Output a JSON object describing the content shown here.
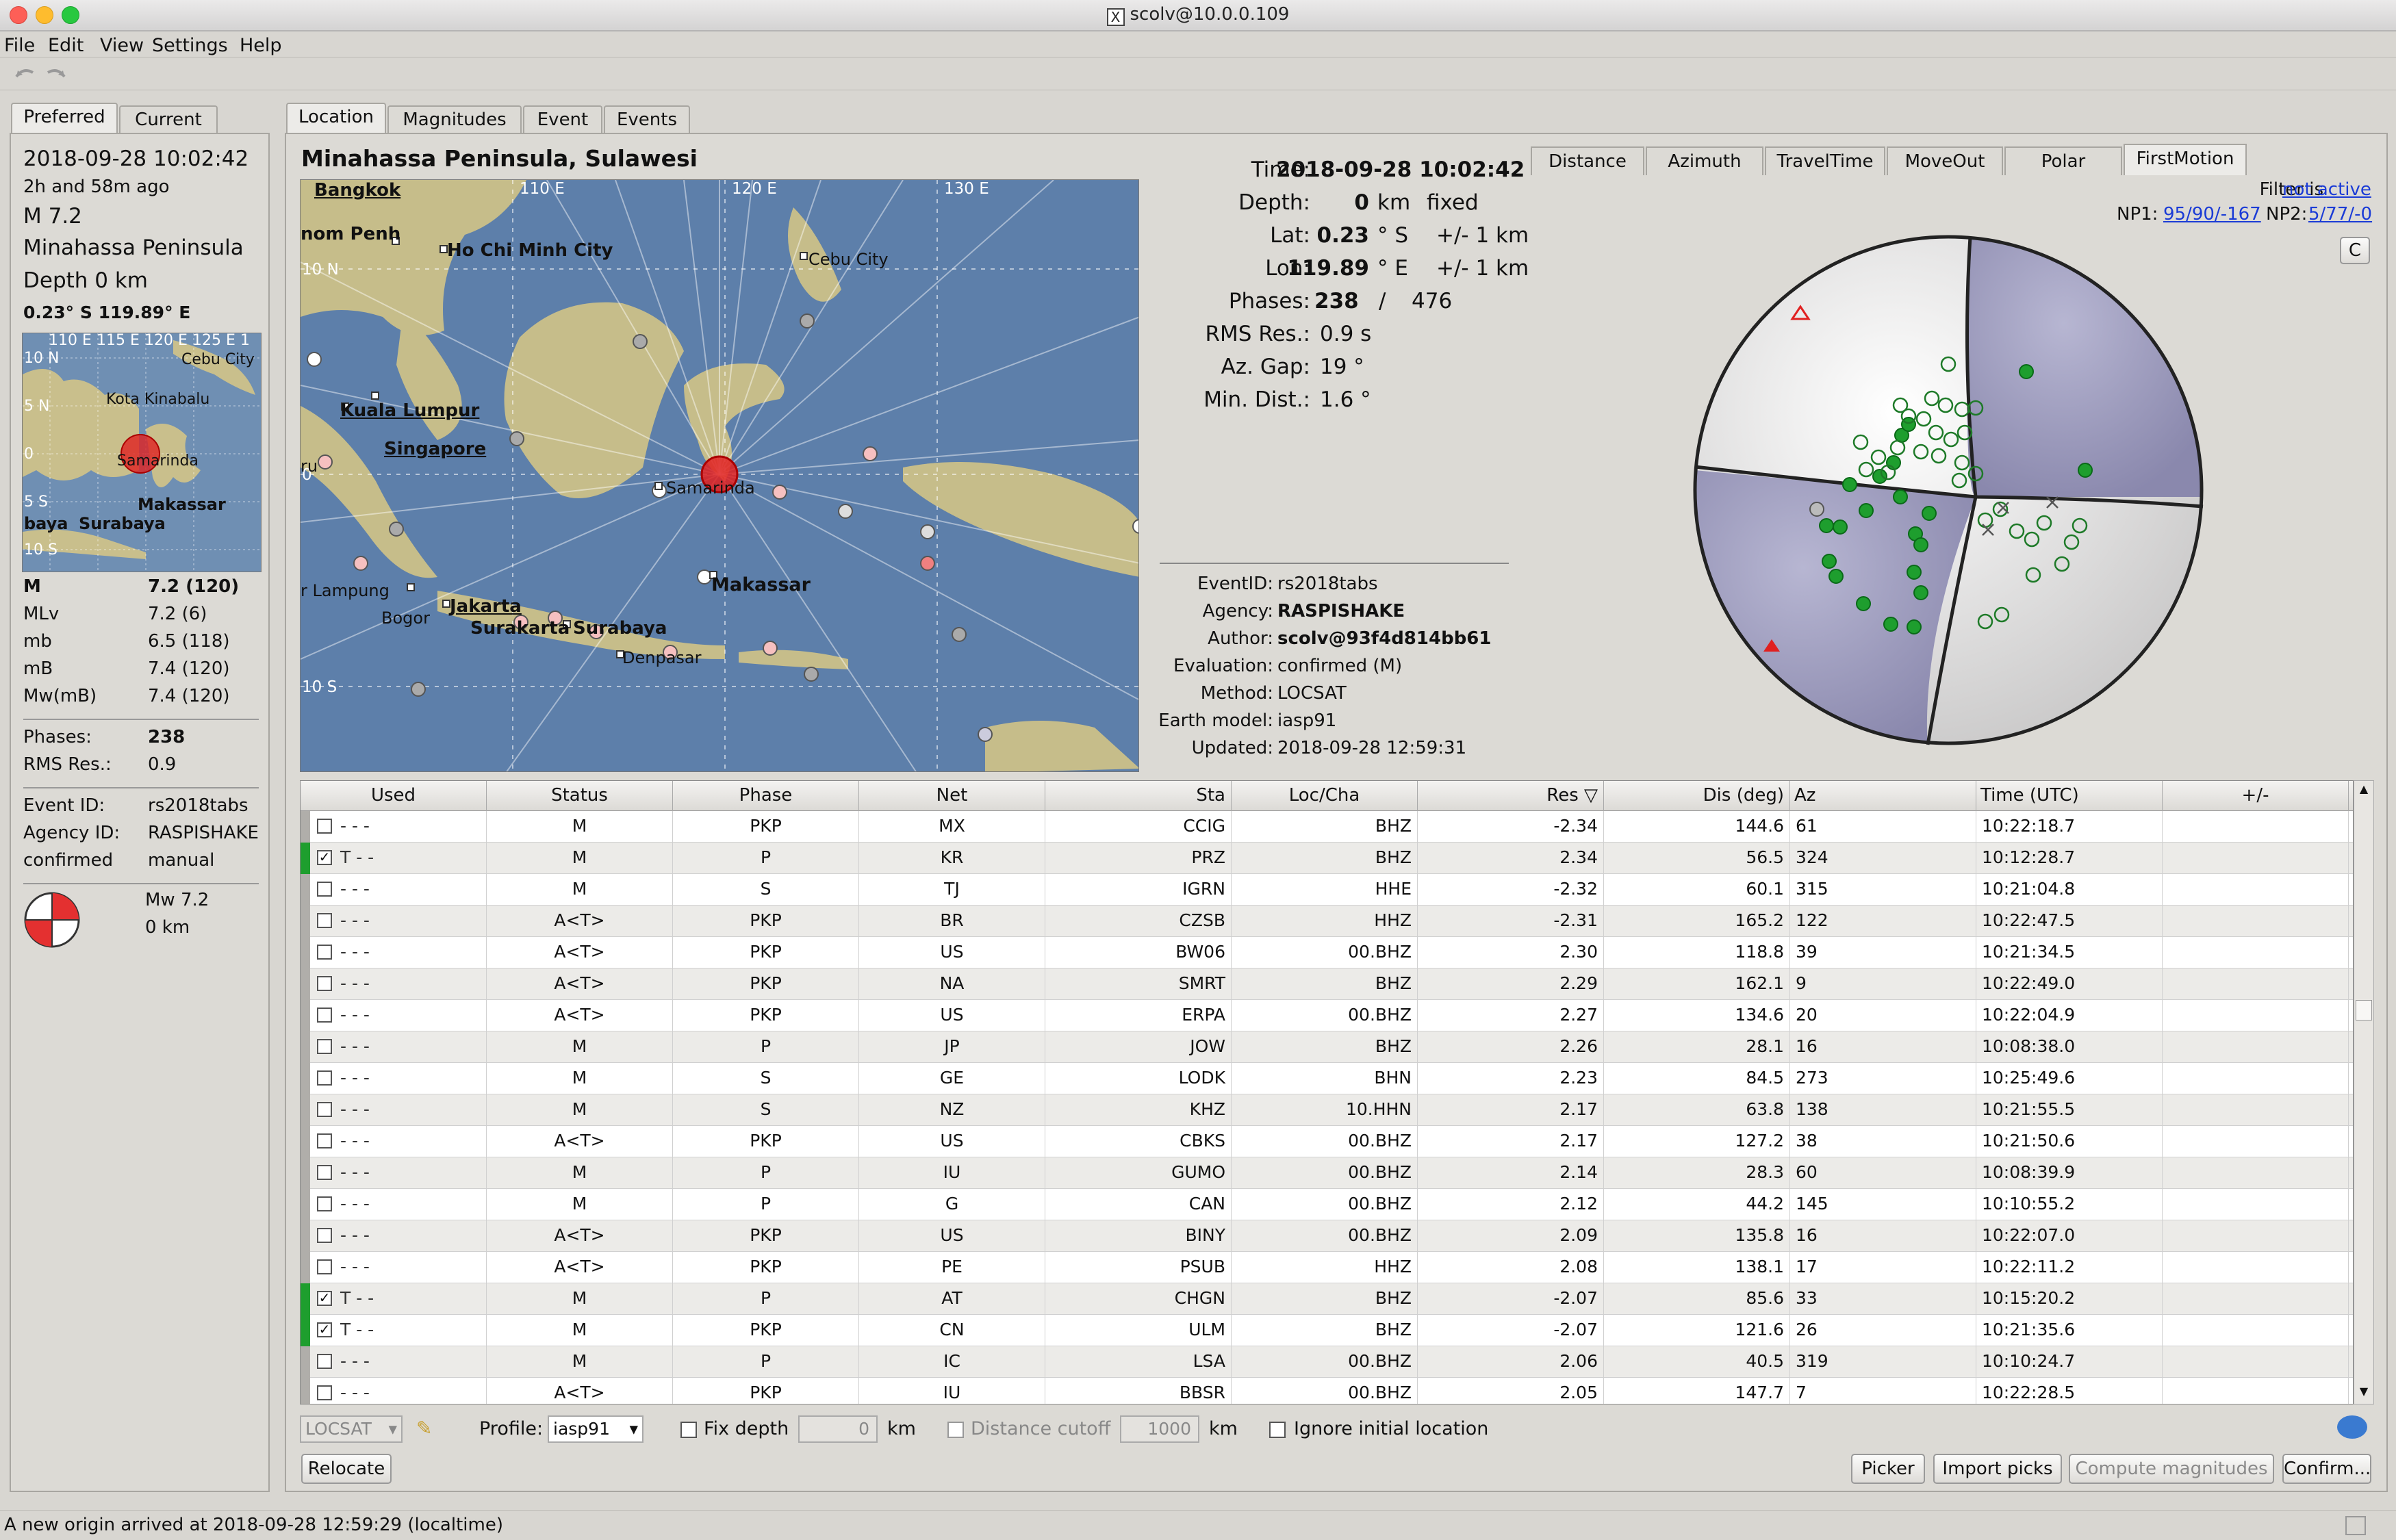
{
  "window": {
    "title": "scolv@10.0.0.109"
  },
  "menu": [
    "File",
    "Edit",
    "View",
    "Settings",
    "Help"
  ],
  "left_tabs": {
    "preferred": "Preferred",
    "current": "Current"
  },
  "left": {
    "time": "2018-09-28 10:02:42",
    "ago": "2h and 58m ago",
    "mag": "M 7.2",
    "region": "Minahassa Peninsula",
    "depth": "Depth 0 km",
    "coords": "0.23° S  119.89° E",
    "mags": [
      {
        "k": "M",
        "v": "7.2 (120)"
      },
      {
        "k": "MLv",
        "v": "7.2 (6)"
      },
      {
        "k": "mb",
        "v": "6.5 (118)"
      },
      {
        "k": "mB",
        "v": "7.4 (120)"
      },
      {
        "k": "Mw(mB)",
        "v": "7.4 (120)"
      }
    ],
    "phases_k": "Phases:",
    "phases_v": "238",
    "rms_k": "RMS Res.:",
    "rms_v": "0.9",
    "eventid_k": "Event ID:",
    "eventid_v": "rs2018tabs",
    "agency_k": "Agency ID:",
    "agency_v": "RASPISHAKE",
    "status_k": "confirmed",
    "status_v": "manual",
    "fm_mag": "Mw 7.2",
    "fm_depth": "0 km"
  },
  "small_map": {
    "ticks": [
      "110 E",
      "115 E",
      "120 E",
      "125 E",
      "1"
    ],
    "lat": [
      "10 N",
      "5 N",
      "0",
      "5 S",
      "10 S"
    ],
    "cities": [
      "Cebu City",
      "Kota Kinabalu",
      "Samarinda",
      "Makassar",
      "Surabaya",
      "baya"
    ]
  },
  "main_tabs": [
    "Location",
    "Magnitudes",
    "Event",
    "Events"
  ],
  "region_title": "Minahassa Peninsula, Sulawesi",
  "big_map": {
    "lon_ticks": [
      "110 E",
      "120 E",
      "130 E"
    ],
    "lat_ticks": [
      "10 N",
      "0",
      "10 S"
    ],
    "cities": {
      "bangkok": "Bangkok",
      "phnom": "nom Penh",
      "hcm": "Ho Chi Minh City",
      "cebu": "Cebu City",
      "kl": "Kuala Lumpur",
      "sing": "Singapore",
      "ru": "ru",
      "samarinda": "Samarinda",
      "makassar": "Makassar",
      "lampung": "r Lampung",
      "bogor": "Bogor",
      "jakarta": "Jakarta",
      "surakarta": "Surakarta",
      "surabaya": "Surabaya",
      "denpasar": "Denpasar"
    }
  },
  "origin": {
    "time_k": "Time:",
    "time_v": "2018-09-28 10:02:42",
    "depth_k": "Depth:",
    "depth_v": "0",
    "depth_u": "km",
    "depth_f": "fixed",
    "lat_k": "Lat:",
    "lat_v": "0.23",
    "lat_u": "° S",
    "lat_e": "+/- 1 km",
    "lon_k": "Lon:",
    "lon_v": "119.89",
    "lon_u": "° E",
    "lon_e": "+/- 1 km",
    "phases_k": "Phases:",
    "phases_used": "238",
    "phases_sep": "/",
    "phases_total": "476",
    "rms_k": "RMS Res.:",
    "rms_v": "0.9 s",
    "gap_k": "Az. Gap:",
    "gap_v": "19 °",
    "dist_k": "Min. Dist.:",
    "dist_v": "1.6 °"
  },
  "meta": [
    {
      "k": "EventID:",
      "v": "rs2018tabs",
      "b": false
    },
    {
      "k": "Agency:",
      "v": "RASPISHAKE",
      "b": true
    },
    {
      "k": "Author:",
      "v": "scolv@93f4d814bb61",
      "b": true
    },
    {
      "k": "Evaluation:",
      "v": "confirmed (M)",
      "b": false
    },
    {
      "k": "Method:",
      "v": "LOCSAT",
      "b": false
    },
    {
      "k": "Earth model:",
      "v": "iasp91",
      "b": false
    },
    {
      "k": "Updated:",
      "v": "2018-09-28 12:59:31",
      "b": false
    }
  ],
  "right_tabs": [
    "Distance",
    "Azimuth",
    "TravelTime",
    "MoveOut",
    "Polar",
    "FirstMotion"
  ],
  "filter": {
    "label": "Filter is",
    "link": "not active"
  },
  "np": {
    "np1_k": "NP1:",
    "np1_v": "95/90/-167",
    "np2_k": "NP2:",
    "np2_v": "5/77/-0"
  },
  "corner_btn": "C",
  "table": {
    "headers": [
      "Used",
      "Status",
      "Phase",
      "Net",
      "Sta",
      "Loc/Cha",
      "Res ▽",
      "Dis (deg)",
      "Az",
      "Time (UTC)",
      "+/-"
    ],
    "rows": [
      {
        "used": false,
        "t": "-",
        "status": "M",
        "phase": "PKP",
        "net": "MX",
        "sta": "CCIG",
        "loc": "BHZ",
        "res": "-2.34",
        "dis": "144.6",
        "az": "61",
        "time": "10:22:18.7"
      },
      {
        "used": true,
        "t": "T",
        "status": "M",
        "phase": "P",
        "net": "KR",
        "sta": "PRZ",
        "loc": "BHZ",
        "res": "2.34",
        "dis": "56.5",
        "az": "324",
        "time": "10:12:28.7"
      },
      {
        "used": false,
        "t": "-",
        "status": "M",
        "phase": "S",
        "net": "TJ",
        "sta": "IGRN",
        "loc": "HHE",
        "res": "-2.32",
        "dis": "60.1",
        "az": "315",
        "time": "10:21:04.8"
      },
      {
        "used": false,
        "t": "-",
        "status": "A<T>",
        "phase": "PKP",
        "net": "BR",
        "sta": "CZSB",
        "loc": "HHZ",
        "res": "-2.31",
        "dis": "165.2",
        "az": "122",
        "time": "10:22:47.5"
      },
      {
        "used": false,
        "t": "-",
        "status": "A<T>",
        "phase": "PKP",
        "net": "US",
        "sta": "BW06",
        "loc": "00.BHZ",
        "res": "2.30",
        "dis": "118.8",
        "az": "39",
        "time": "10:21:34.5"
      },
      {
        "used": false,
        "t": "-",
        "status": "A<T>",
        "phase": "PKP",
        "net": "NA",
        "sta": "SMRT",
        "loc": "BHZ",
        "res": "2.29",
        "dis": "162.1",
        "az": "9",
        "time": "10:22:49.0"
      },
      {
        "used": false,
        "t": "-",
        "status": "A<T>",
        "phase": "PKP",
        "net": "US",
        "sta": "ERPA",
        "loc": "00.BHZ",
        "res": "2.27",
        "dis": "134.6",
        "az": "20",
        "time": "10:22:04.9"
      },
      {
        "used": false,
        "t": "-",
        "status": "M",
        "phase": "P",
        "net": "JP",
        "sta": "JOW",
        "loc": "BHZ",
        "res": "2.26",
        "dis": "28.1",
        "az": "16",
        "time": "10:08:38.0"
      },
      {
        "used": false,
        "t": "-",
        "status": "M",
        "phase": "S",
        "net": "GE",
        "sta": "LODK",
        "loc": "BHN",
        "res": "2.23",
        "dis": "84.5",
        "az": "273",
        "time": "10:25:49.6"
      },
      {
        "used": false,
        "t": "-",
        "status": "M",
        "phase": "S",
        "net": "NZ",
        "sta": "KHZ",
        "loc": "10.HHN",
        "res": "2.17",
        "dis": "63.8",
        "az": "138",
        "time": "10:21:55.5"
      },
      {
        "used": false,
        "t": "-",
        "status": "A<T>",
        "phase": "PKP",
        "net": "US",
        "sta": "CBKS",
        "loc": "00.BHZ",
        "res": "2.17",
        "dis": "127.2",
        "az": "38",
        "time": "10:21:50.6"
      },
      {
        "used": false,
        "t": "-",
        "status": "M",
        "phase": "P",
        "net": "IU",
        "sta": "GUMO",
        "loc": "00.BHZ",
        "res": "2.14",
        "dis": "28.3",
        "az": "60",
        "time": "10:08:39.9"
      },
      {
        "used": false,
        "t": "-",
        "status": "M",
        "phase": "P",
        "net": "G",
        "sta": "CAN",
        "loc": "00.BHZ",
        "res": "2.12",
        "dis": "44.2",
        "az": "145",
        "time": "10:10:55.2"
      },
      {
        "used": false,
        "t": "-",
        "status": "A<T>",
        "phase": "PKP",
        "net": "US",
        "sta": "BINY",
        "loc": "00.BHZ",
        "res": "2.09",
        "dis": "135.8",
        "az": "16",
        "time": "10:22:07.0"
      },
      {
        "used": false,
        "t": "-",
        "status": "A<T>",
        "phase": "PKP",
        "net": "PE",
        "sta": "PSUB",
        "loc": "HHZ",
        "res": "2.08",
        "dis": "138.1",
        "az": "17",
        "time": "10:22:11.2"
      },
      {
        "used": true,
        "t": "T",
        "status": "M",
        "phase": "P",
        "net": "AT",
        "sta": "CHGN",
        "loc": "BHZ",
        "res": "-2.07",
        "dis": "85.6",
        "az": "33",
        "time": "10:15:20.2"
      },
      {
        "used": true,
        "t": "T",
        "status": "M",
        "phase": "PKP",
        "net": "CN",
        "sta": "ULM",
        "loc": "BHZ",
        "res": "-2.07",
        "dis": "121.6",
        "az": "26",
        "time": "10:21:35.6"
      },
      {
        "used": false,
        "t": "-",
        "status": "M",
        "phase": "P",
        "net": "IC",
        "sta": "LSA",
        "loc": "00.BHZ",
        "res": "2.06",
        "dis": "40.5",
        "az": "319",
        "time": "10:10:24.7"
      },
      {
        "used": false,
        "t": "-",
        "status": "A<T>",
        "phase": "PKP",
        "net": "IU",
        "sta": "BBSR",
        "loc": "00.BHZ",
        "res": "2.05",
        "dis": "147.7",
        "az": "7",
        "time": "10:22:28.5"
      }
    ]
  },
  "controls": {
    "locator": "LOCSAT",
    "profile_label": "Profile:",
    "profile_value": "iasp91",
    "fix_depth": "Fix depth",
    "depth_value": "0",
    "km1": "km",
    "dist_cutoff": "Distance cutoff",
    "cutoff_value": "1000",
    "km2": "km",
    "ignore_initial": "Ignore initial location",
    "relocate": "Relocate",
    "picker": "Picker",
    "import": "Import picks",
    "compute": "Compute magnitudes",
    "confirm": "Confirm..."
  },
  "status_bar": "A new origin arrived at 2018-09-28 12:59:29 (localtime)",
  "colors": {
    "used_green": "#1e9e2e",
    "link_blue": "#1a3bd6",
    "event_red": "#e02020"
  }
}
